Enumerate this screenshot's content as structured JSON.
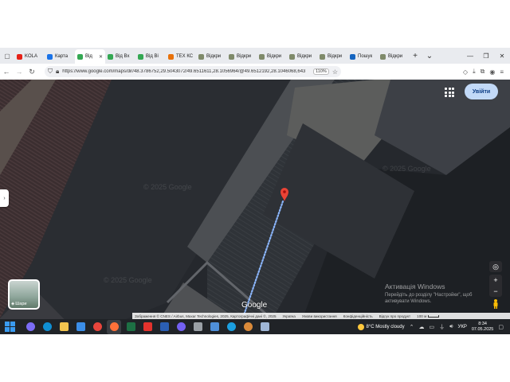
{
  "browser": {
    "tabs": [
      {
        "label": "KOLA",
        "favicon_color": "#e62117"
      },
      {
        "label": "Карта",
        "favicon_color": "#1a73e8"
      },
      {
        "label": "Від",
        "favicon_color": "#34a853",
        "active": true
      },
      {
        "label": "Від Вх",
        "favicon_color": "#34a853"
      },
      {
        "label": "Від Ві",
        "favicon_color": "#34a853"
      },
      {
        "label": "TEX КС",
        "favicon_color": "#e8710a"
      },
      {
        "label": "Відкри",
        "favicon_color": "#7f8a6a"
      },
      {
        "label": "Відкри",
        "favicon_color": "#7f8a6a"
      },
      {
        "label": "Відкри",
        "favicon_color": "#7f8a6a"
      },
      {
        "label": "Відкри",
        "favicon_color": "#7f8a6a"
      },
      {
        "label": "Відкри",
        "favicon_color": "#7f8a6a"
      },
      {
        "label": "Пошук",
        "favicon_color": "#1565c0"
      },
      {
        "label": "Відкри",
        "favicon_color": "#7f8a6a"
      }
    ],
    "close_tab_glyph": "✕",
    "new_tab_glyph": "+",
    "tab_list_glyph": "⌄",
    "window_controls": {
      "minimize": "—",
      "maximize": "❐",
      "close": "✕"
    },
    "url": "https://www.google.com/maps/dir/48.3786752,29.5043072/49.6511611,28.1056964/@49.6512192,28.1046068,643",
    "zoom": "110%"
  },
  "map": {
    "sign_in_label": "Увійти",
    "layers_label": "Шари",
    "google_logo": "Google",
    "watermarks": [
      "© 2025 Google",
      "© 2025 Google",
      "© 2025 Google"
    ],
    "attribution": {
      "imagery": "Зображення © CNES / Airbus, Maxar Technologies, 2025, Картографічні дані ©, 2025",
      "country": "Україна",
      "terms": "Умови використання",
      "privacy": "Конфіденційність",
      "feedback": "Відгук про продукт",
      "scale": "100 м"
    },
    "activation": {
      "title": "Активація Windows",
      "line1": "Перейдіть до розділу \"Настройки\", щоб",
      "line2": "активувати Windows."
    },
    "pin_color": "#ea4335",
    "route_color": "#8ab4f8"
  },
  "taskbar": {
    "weather": "8°C  Mostly cloudy",
    "language": "УКР",
    "time": "8:34",
    "date": "07.05.2025",
    "apps": [
      {
        "name": "copilot",
        "color": "#7b6cf6"
      },
      {
        "name": "edge",
        "color": "#0f8fd3"
      },
      {
        "name": "explorer",
        "color": "#f2c44f"
      },
      {
        "name": "store",
        "color": "#3b8ee8"
      },
      {
        "name": "chrome",
        "color": "#e8453c"
      },
      {
        "name": "firefox",
        "color": "#ff7139",
        "active": true
      },
      {
        "name": "excel",
        "color": "#1d7044"
      },
      {
        "name": "acrobat",
        "color": "#e3322d"
      },
      {
        "name": "word",
        "color": "#2b5fb4"
      },
      {
        "name": "viber",
        "color": "#7360f2"
      },
      {
        "name": "app-gray",
        "color": "#9aa0a6"
      },
      {
        "name": "app-blue",
        "color": "#4f8fd9"
      },
      {
        "name": "app-skype",
        "color": "#1b9fe0"
      },
      {
        "name": "app-pet",
        "color": "#d98a3a"
      },
      {
        "name": "app-doc",
        "color": "#9fb6d6"
      }
    ]
  }
}
